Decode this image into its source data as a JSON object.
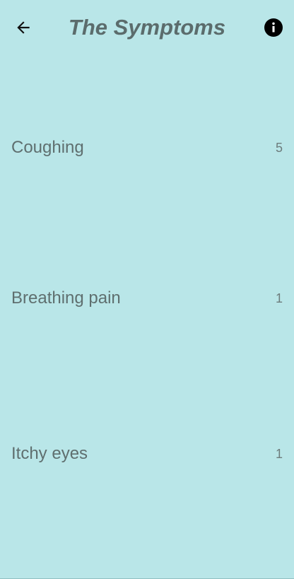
{
  "header": {
    "title": "The Symptoms",
    "back_icon": "arrow-left-icon",
    "info_icon": "info-icon"
  },
  "symptoms": [
    {
      "label": "Coughing",
      "count": "5"
    },
    {
      "label": "Breathing pain",
      "count": "1"
    },
    {
      "label": "Itchy eyes",
      "count": "1"
    }
  ],
  "colors": {
    "background": "#b9e6e8",
    "title": "#5b6c6c",
    "text": "#5f6f6f"
  }
}
